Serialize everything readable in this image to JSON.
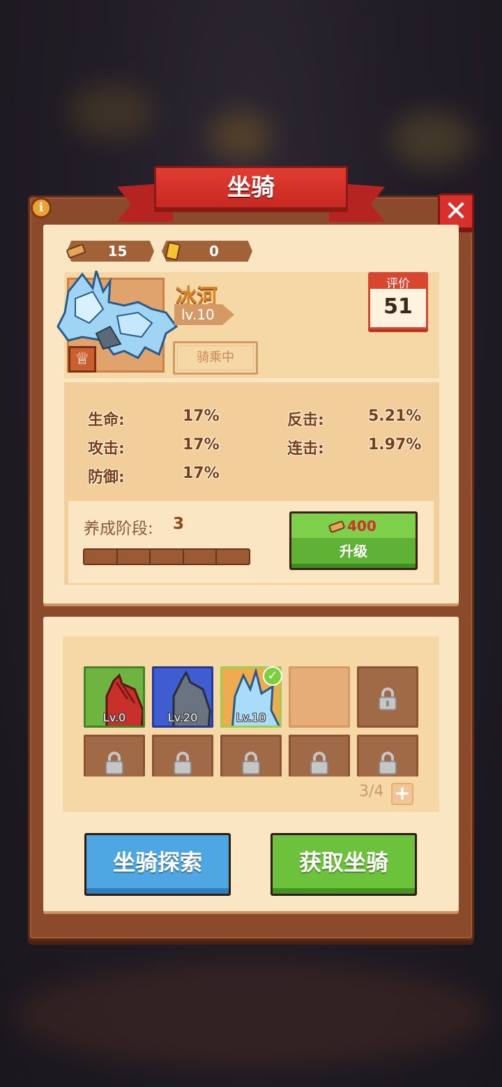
{
  "title": "坐骑",
  "currency": {
    "wood": "15",
    "ticket": "0"
  },
  "mount": {
    "name": "冰河",
    "level": "lv.10",
    "status": "骑乘中",
    "rating_label": "评价",
    "rating": "51"
  },
  "stats": [
    {
      "label": "生命:",
      "value": "17%"
    },
    {
      "label": "攻击:",
      "value": "17%"
    },
    {
      "label": "防御:",
      "value": "17%"
    },
    {
      "label": "反击:",
      "value": "5.21%"
    },
    {
      "label": "连击:",
      "value": "1.97%"
    }
  ],
  "training": {
    "label": "养成阶段:",
    "stage": "3",
    "progress_segments_filled": 5,
    "progress_segments_total": 5
  },
  "upgrade": {
    "cost": "400",
    "label": "升级"
  },
  "mounts": [
    {
      "level": "Lv.0",
      "rarity": "green"
    },
    {
      "level": "Lv.20",
      "rarity": "blue"
    },
    {
      "level": "Lv.10",
      "rarity": "gold",
      "selected": true
    }
  ],
  "capacity": "3/4",
  "buttons": {
    "explore": "坐骑探索",
    "acquire": "获取坐骑"
  },
  "colors": {
    "accent_red": "#d8302a",
    "frame_brown": "#8b4a2b",
    "panel_cream": "#fbe6c4",
    "green_button": "#6cc23a",
    "blue_button": "#4ea6e2"
  }
}
